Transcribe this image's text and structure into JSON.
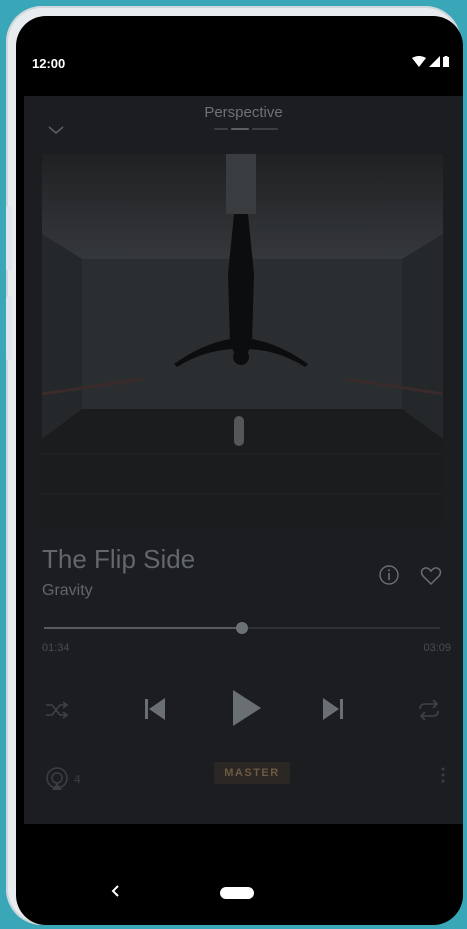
{
  "status_bar": {
    "time": "12:00"
  },
  "player": {
    "header_title": "Perspective",
    "track_title": "The Flip Side",
    "artist": "Gravity",
    "progress": {
      "elapsed": "01:34",
      "total": "03:09",
      "fraction": 0.5
    },
    "cast_count": "4",
    "quality_badge": "MASTER"
  },
  "icons": {
    "collapse": "chevron-down-icon",
    "info": "info-icon",
    "favorite": "heart-icon",
    "shuffle": "shuffle-icon",
    "previous": "skip-previous-icon",
    "play": "play-icon",
    "next": "skip-next-icon",
    "repeat": "repeat-icon",
    "cast": "cast-icon",
    "more": "more-vertical-icon"
  },
  "colors": {
    "accent_badge_text": "#6e5a40",
    "player_bg": "#1b1d20",
    "device_frame": "#e9ecef",
    "background": "#3aa7b8"
  }
}
